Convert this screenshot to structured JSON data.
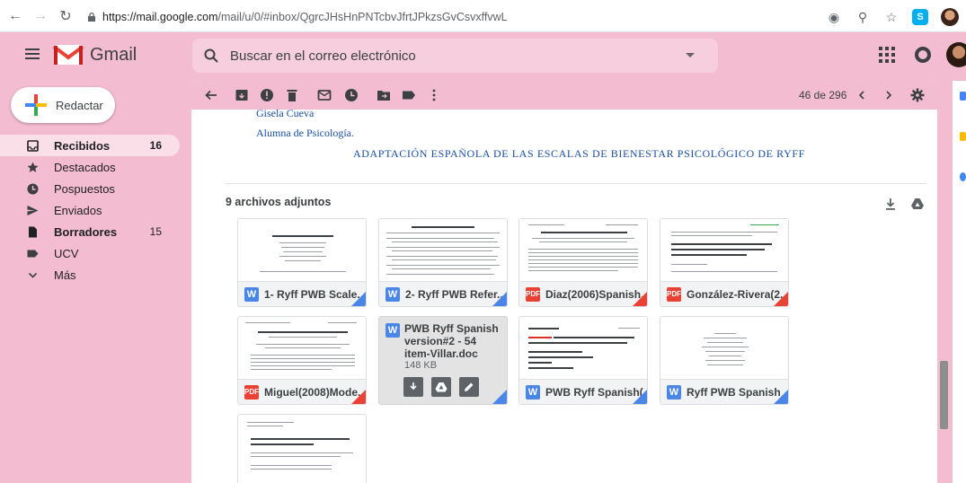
{
  "browser": {
    "url_host": "https://mail.google.com",
    "url_path": "/mail/u/0/#inbox/QgrcJHsHnPNTcbvJfrtJPkzsGvCsvxffvwL"
  },
  "header": {
    "app_name": "Gmail",
    "search_placeholder": "Buscar en el correo electrónico"
  },
  "sidebar": {
    "compose_label": "Redactar",
    "items": [
      {
        "label": "Recibidos",
        "count": "16",
        "icon": "inbox-icon",
        "bold": true,
        "active": true
      },
      {
        "label": "Destacados",
        "count": "",
        "icon": "star-icon",
        "bold": false,
        "active": false
      },
      {
        "label": "Pospuestos",
        "count": "",
        "icon": "clock-icon",
        "bold": false,
        "active": false
      },
      {
        "label": "Enviados",
        "count": "",
        "icon": "send-icon",
        "bold": false,
        "active": false
      },
      {
        "label": "Borradores",
        "count": "15",
        "icon": "draft-icon",
        "bold": true,
        "active": false
      },
      {
        "label": "UCV",
        "count": "",
        "icon": "label-icon",
        "bold": false,
        "active": false
      },
      {
        "label": "Más",
        "count": "",
        "icon": "chevron-down-icon",
        "bold": false,
        "active": false
      }
    ]
  },
  "toolbar": {
    "pager": "46 de 296"
  },
  "message": {
    "signature_name": "Gisela Cueva",
    "signature_role": "Alumna de Psicología.",
    "doc_title": "ADAPTACIÓN ESPAÑOLA DE LAS ESCALAS DE BIENESTAR PSICOLÓGICO DE RYFF"
  },
  "attachments": {
    "header": "9 archivos adjuntos",
    "items": [
      {
        "name": "1- Ryff PWB Scale...",
        "type": "W",
        "corner": "blue"
      },
      {
        "name": "2- Ryff PWB Refer...",
        "type": "W",
        "corner": "blue"
      },
      {
        "name": "Diaz(2006)Spanish...",
        "type": "PDF",
        "corner": "red"
      },
      {
        "name": "González-Rivera(2...",
        "type": "PDF",
        "corner": "red"
      },
      {
        "name": "Miguel(2008)Mode...",
        "type": "PDF",
        "corner": "red"
      },
      {
        "name": "PWB Ryff Spanish version#2 - 54 item-Villar.doc",
        "type": "W",
        "size": "148 KB",
        "corner": "blue",
        "hover": true
      },
      {
        "name": "PWB Ryff Spanish(...",
        "type": "W",
        "corner": "blue"
      },
      {
        "name": "Ryff PWB Spanish ...",
        "type": "W",
        "corner": "blue"
      }
    ]
  },
  "colors": {
    "theme_background": "#f4bcd0",
    "link_blue": "#1a4fa3",
    "word_blue": "#4a86e8",
    "pdf_red": "#ea4335"
  }
}
